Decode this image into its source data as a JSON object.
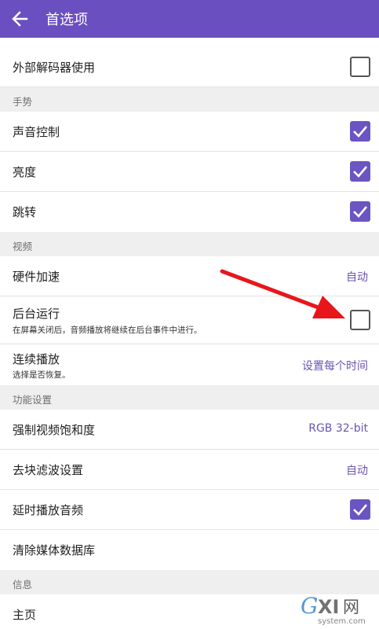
{
  "appbar": {
    "title": "首选项",
    "back_icon": "arrow-left-icon",
    "background": "#6a4fc0"
  },
  "rows": {
    "external_decoder": {
      "label": "外部解码器使用",
      "checked": false
    },
    "gesture_section": "手势",
    "sound_control": {
      "label": "声音控制",
      "checked": true
    },
    "brightness": {
      "label": "亮度",
      "checked": true
    },
    "seek": {
      "label": "跳转",
      "checked": true
    },
    "video_section": "视频",
    "hw_accel": {
      "label": "硬件加速",
      "value": "自动"
    },
    "background_play": {
      "label": "后台运行",
      "summary": "在屏幕关闭后，音频播放将继续在后台事件中进行。",
      "checked": false
    },
    "continuous_play": {
      "label": "连续播放",
      "summary": "选择是否恢复。",
      "value": "设置每个时间"
    },
    "function_section": "功能设置",
    "force_saturation": {
      "label": "强制视频饱和度",
      "value": "RGB 32-bit"
    },
    "deblocking": {
      "label": "去块滤波设置",
      "value": "自动"
    },
    "delay_audio": {
      "label": "延时播放音频",
      "checked": true
    },
    "clear_media_db": {
      "label": "清除媒体数据库"
    },
    "info_section": "信息",
    "homepage": {
      "label": "主页"
    }
  },
  "colors": {
    "accent": "#6a55c2",
    "annotation_arrow": "#e8161b"
  },
  "watermark": {
    "brand": "GXI网",
    "domain": "system.com"
  }
}
